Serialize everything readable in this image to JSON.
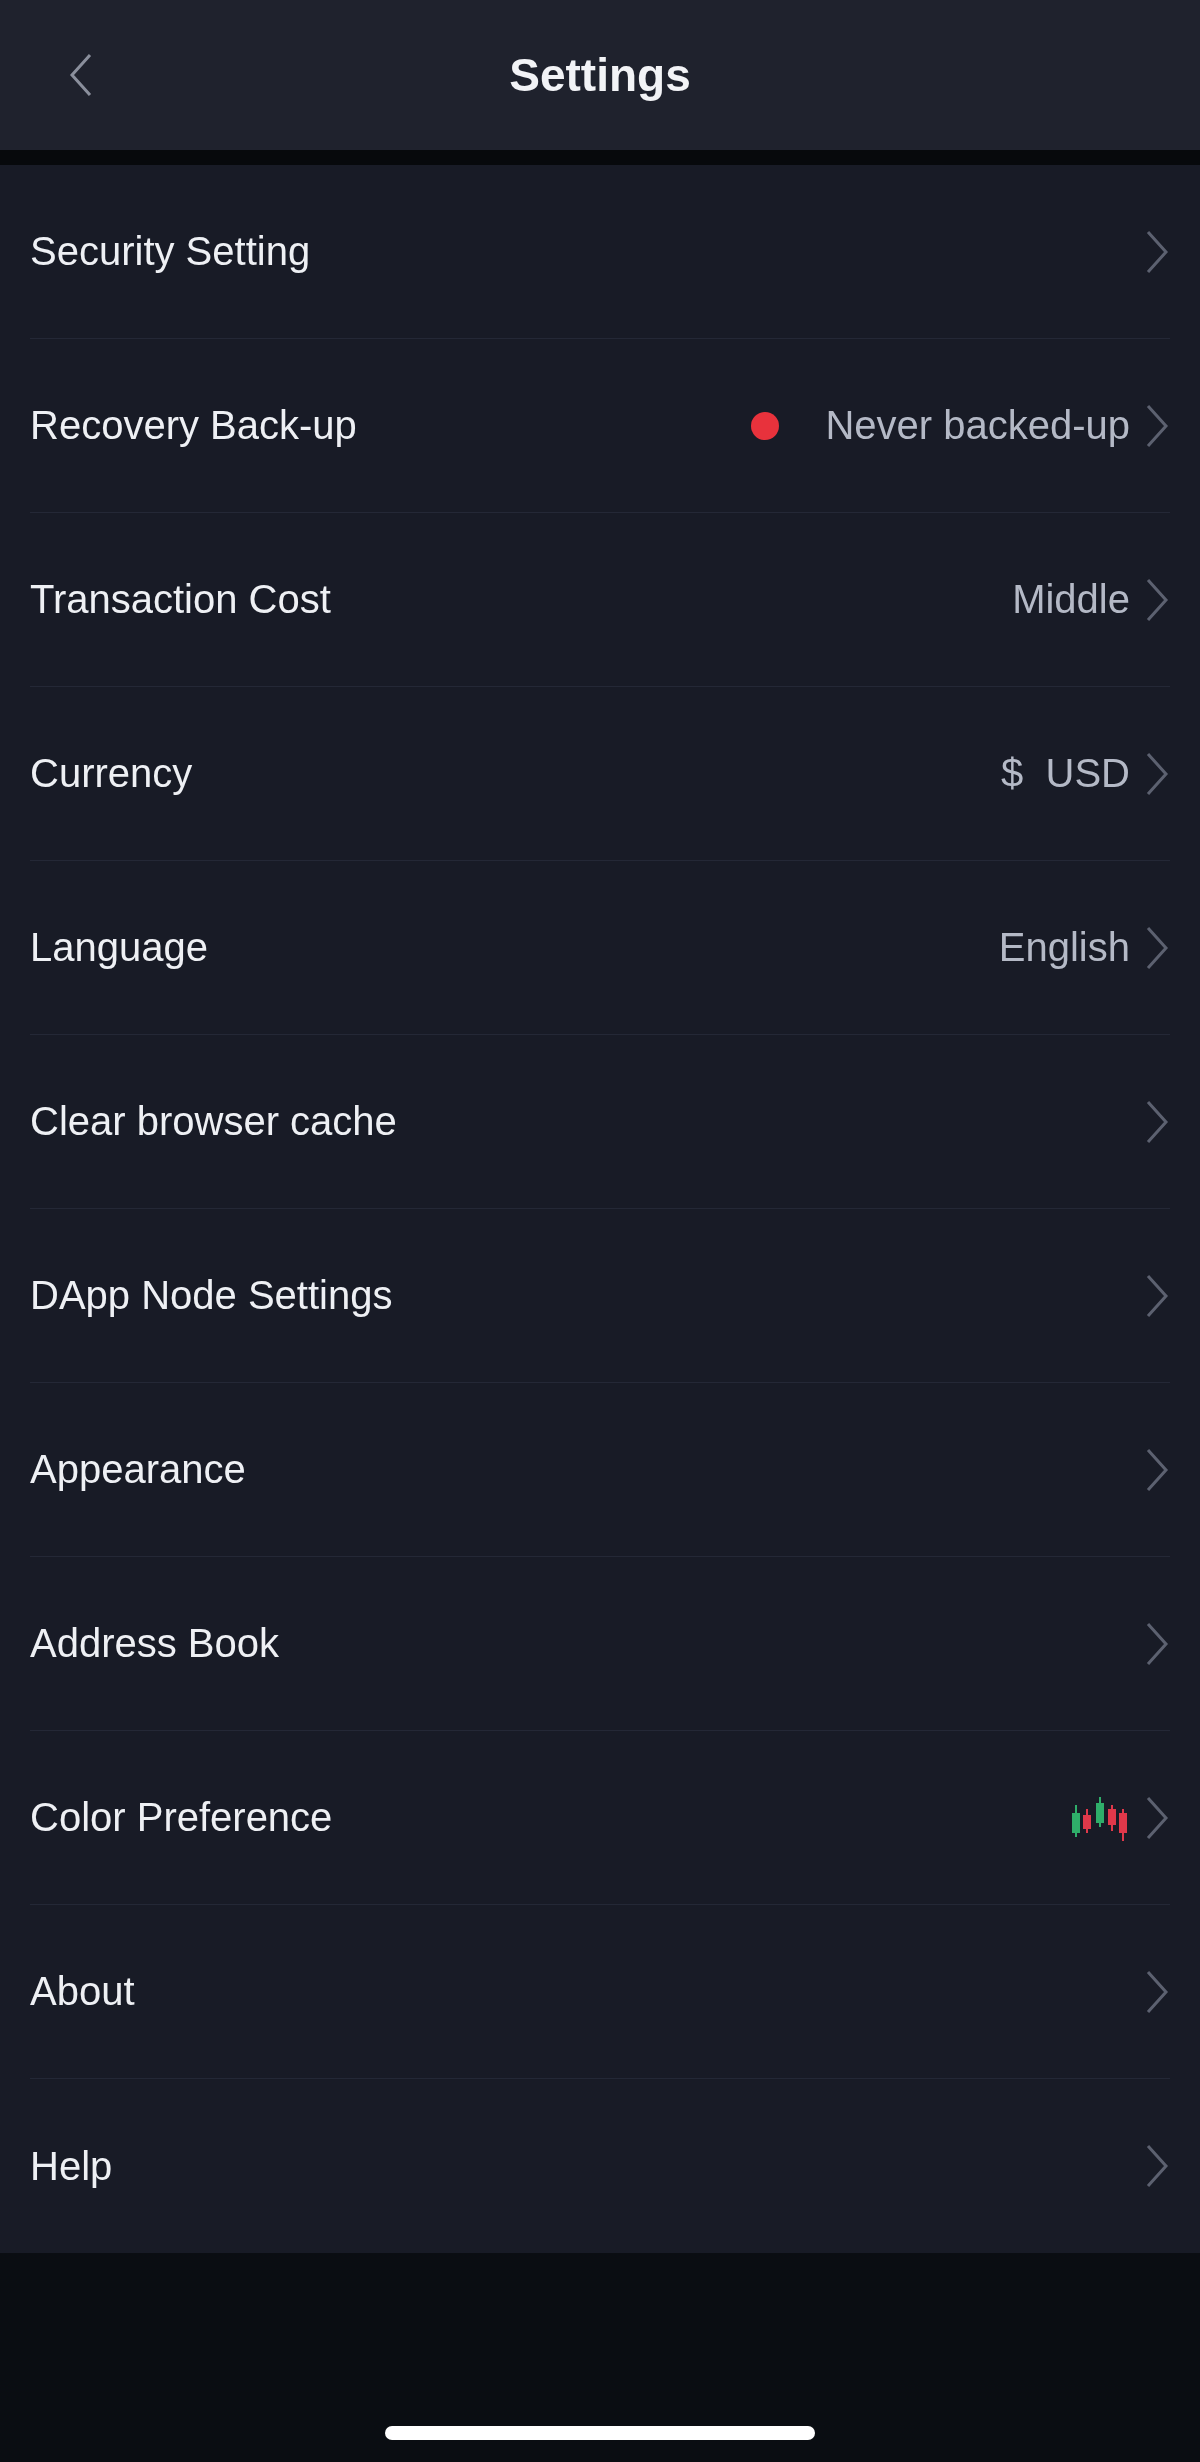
{
  "header": {
    "title": "Settings"
  },
  "rows": [
    {
      "kind": "plain",
      "label": "Security Setting"
    },
    {
      "kind": "status",
      "label": "Recovery Back-up",
      "value": "Never backed-up",
      "color": "#e8323c"
    },
    {
      "kind": "value",
      "label": "Transaction Cost",
      "value": "Middle"
    },
    {
      "kind": "value",
      "label": "Currency",
      "value": "$  USD"
    },
    {
      "kind": "value",
      "label": "Language",
      "value": "English"
    },
    {
      "kind": "plain",
      "label": "Clear browser cache"
    },
    {
      "kind": "plain",
      "label": "DApp Node Settings"
    },
    {
      "kind": "plain",
      "label": "Appearance"
    },
    {
      "kind": "plain",
      "label": "Address Book"
    },
    {
      "kind": "candles",
      "label": "Color Preference"
    },
    {
      "kind": "plain",
      "label": "About"
    },
    {
      "kind": "plain",
      "label": "Help"
    }
  ]
}
